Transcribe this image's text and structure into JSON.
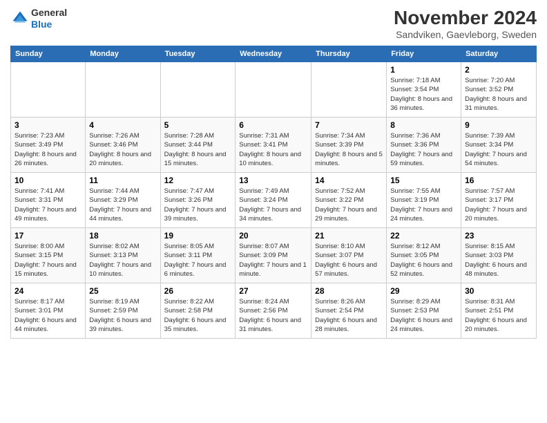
{
  "header": {
    "logo_line1": "General",
    "logo_line2": "Blue",
    "month_title": "November 2024",
    "location": "Sandviken, Gaevleborg, Sweden"
  },
  "days_of_week": [
    "Sunday",
    "Monday",
    "Tuesday",
    "Wednesday",
    "Thursday",
    "Friday",
    "Saturday"
  ],
  "weeks": [
    [
      {
        "day": "",
        "sunrise": "",
        "sunset": "",
        "daylight": ""
      },
      {
        "day": "",
        "sunrise": "",
        "sunset": "",
        "daylight": ""
      },
      {
        "day": "",
        "sunrise": "",
        "sunset": "",
        "daylight": ""
      },
      {
        "day": "",
        "sunrise": "",
        "sunset": "",
        "daylight": ""
      },
      {
        "day": "",
        "sunrise": "",
        "sunset": "",
        "daylight": ""
      },
      {
        "day": "1",
        "sunrise": "Sunrise: 7:18 AM",
        "sunset": "Sunset: 3:54 PM",
        "daylight": "Daylight: 8 hours and 36 minutes."
      },
      {
        "day": "2",
        "sunrise": "Sunrise: 7:20 AM",
        "sunset": "Sunset: 3:52 PM",
        "daylight": "Daylight: 8 hours and 31 minutes."
      }
    ],
    [
      {
        "day": "3",
        "sunrise": "Sunrise: 7:23 AM",
        "sunset": "Sunset: 3:49 PM",
        "daylight": "Daylight: 8 hours and 26 minutes."
      },
      {
        "day": "4",
        "sunrise": "Sunrise: 7:26 AM",
        "sunset": "Sunset: 3:46 PM",
        "daylight": "Daylight: 8 hours and 20 minutes."
      },
      {
        "day": "5",
        "sunrise": "Sunrise: 7:28 AM",
        "sunset": "Sunset: 3:44 PM",
        "daylight": "Daylight: 8 hours and 15 minutes."
      },
      {
        "day": "6",
        "sunrise": "Sunrise: 7:31 AM",
        "sunset": "Sunset: 3:41 PM",
        "daylight": "Daylight: 8 hours and 10 minutes."
      },
      {
        "day": "7",
        "sunrise": "Sunrise: 7:34 AM",
        "sunset": "Sunset: 3:39 PM",
        "daylight": "Daylight: 8 hours and 5 minutes."
      },
      {
        "day": "8",
        "sunrise": "Sunrise: 7:36 AM",
        "sunset": "Sunset: 3:36 PM",
        "daylight": "Daylight: 7 hours and 59 minutes."
      },
      {
        "day": "9",
        "sunrise": "Sunrise: 7:39 AM",
        "sunset": "Sunset: 3:34 PM",
        "daylight": "Daylight: 7 hours and 54 minutes."
      }
    ],
    [
      {
        "day": "10",
        "sunrise": "Sunrise: 7:41 AM",
        "sunset": "Sunset: 3:31 PM",
        "daylight": "Daylight: 7 hours and 49 minutes."
      },
      {
        "day": "11",
        "sunrise": "Sunrise: 7:44 AM",
        "sunset": "Sunset: 3:29 PM",
        "daylight": "Daylight: 7 hours and 44 minutes."
      },
      {
        "day": "12",
        "sunrise": "Sunrise: 7:47 AM",
        "sunset": "Sunset: 3:26 PM",
        "daylight": "Daylight: 7 hours and 39 minutes."
      },
      {
        "day": "13",
        "sunrise": "Sunrise: 7:49 AM",
        "sunset": "Sunset: 3:24 PM",
        "daylight": "Daylight: 7 hours and 34 minutes."
      },
      {
        "day": "14",
        "sunrise": "Sunrise: 7:52 AM",
        "sunset": "Sunset: 3:22 PM",
        "daylight": "Daylight: 7 hours and 29 minutes."
      },
      {
        "day": "15",
        "sunrise": "Sunrise: 7:55 AM",
        "sunset": "Sunset: 3:19 PM",
        "daylight": "Daylight: 7 hours and 24 minutes."
      },
      {
        "day": "16",
        "sunrise": "Sunrise: 7:57 AM",
        "sunset": "Sunset: 3:17 PM",
        "daylight": "Daylight: 7 hours and 20 minutes."
      }
    ],
    [
      {
        "day": "17",
        "sunrise": "Sunrise: 8:00 AM",
        "sunset": "Sunset: 3:15 PM",
        "daylight": "Daylight: 7 hours and 15 minutes."
      },
      {
        "day": "18",
        "sunrise": "Sunrise: 8:02 AM",
        "sunset": "Sunset: 3:13 PM",
        "daylight": "Daylight: 7 hours and 10 minutes."
      },
      {
        "day": "19",
        "sunrise": "Sunrise: 8:05 AM",
        "sunset": "Sunset: 3:11 PM",
        "daylight": "Daylight: 7 hours and 6 minutes."
      },
      {
        "day": "20",
        "sunrise": "Sunrise: 8:07 AM",
        "sunset": "Sunset: 3:09 PM",
        "daylight": "Daylight: 7 hours and 1 minute."
      },
      {
        "day": "21",
        "sunrise": "Sunrise: 8:10 AM",
        "sunset": "Sunset: 3:07 PM",
        "daylight": "Daylight: 6 hours and 57 minutes."
      },
      {
        "day": "22",
        "sunrise": "Sunrise: 8:12 AM",
        "sunset": "Sunset: 3:05 PM",
        "daylight": "Daylight: 6 hours and 52 minutes."
      },
      {
        "day": "23",
        "sunrise": "Sunrise: 8:15 AM",
        "sunset": "Sunset: 3:03 PM",
        "daylight": "Daylight: 6 hours and 48 minutes."
      }
    ],
    [
      {
        "day": "24",
        "sunrise": "Sunrise: 8:17 AM",
        "sunset": "Sunset: 3:01 PM",
        "daylight": "Daylight: 6 hours and 44 minutes."
      },
      {
        "day": "25",
        "sunrise": "Sunrise: 8:19 AM",
        "sunset": "Sunset: 2:59 PM",
        "daylight": "Daylight: 6 hours and 39 minutes."
      },
      {
        "day": "26",
        "sunrise": "Sunrise: 8:22 AM",
        "sunset": "Sunset: 2:58 PM",
        "daylight": "Daylight: 6 hours and 35 minutes."
      },
      {
        "day": "27",
        "sunrise": "Sunrise: 8:24 AM",
        "sunset": "Sunset: 2:56 PM",
        "daylight": "Daylight: 6 hours and 31 minutes."
      },
      {
        "day": "28",
        "sunrise": "Sunrise: 8:26 AM",
        "sunset": "Sunset: 2:54 PM",
        "daylight": "Daylight: 6 hours and 28 minutes."
      },
      {
        "day": "29",
        "sunrise": "Sunrise: 8:29 AM",
        "sunset": "Sunset: 2:53 PM",
        "daylight": "Daylight: 6 hours and 24 minutes."
      },
      {
        "day": "30",
        "sunrise": "Sunrise: 8:31 AM",
        "sunset": "Sunset: 2:51 PM",
        "daylight": "Daylight: 6 hours and 20 minutes."
      }
    ]
  ]
}
